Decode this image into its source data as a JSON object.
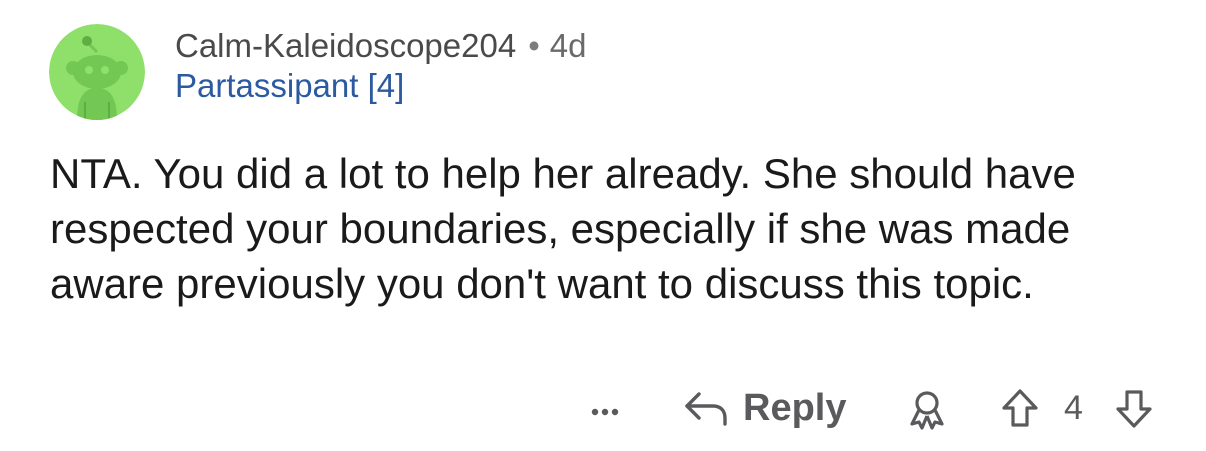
{
  "comment": {
    "author": "Calm-Kaleidoscope204",
    "separator": "•",
    "age": "4d",
    "flair": "Partassipant [4]",
    "avatar_icon": "snoo-avatar-icon",
    "avatar_color": "#8ee06a",
    "body": "NTA. You did a lot to help her already. She should have respected your boundaries, especially if she was made aware previously you don't want to discuss this topic."
  },
  "actions": {
    "more_icon": "more-dots-icon",
    "reply_icon": "reply-arrow-icon",
    "reply_label": "Reply",
    "award_icon": "award-icon",
    "upvote_icon": "upvote-arrow-icon",
    "vote_count": "4",
    "downvote_icon": "downvote-arrow-icon"
  }
}
